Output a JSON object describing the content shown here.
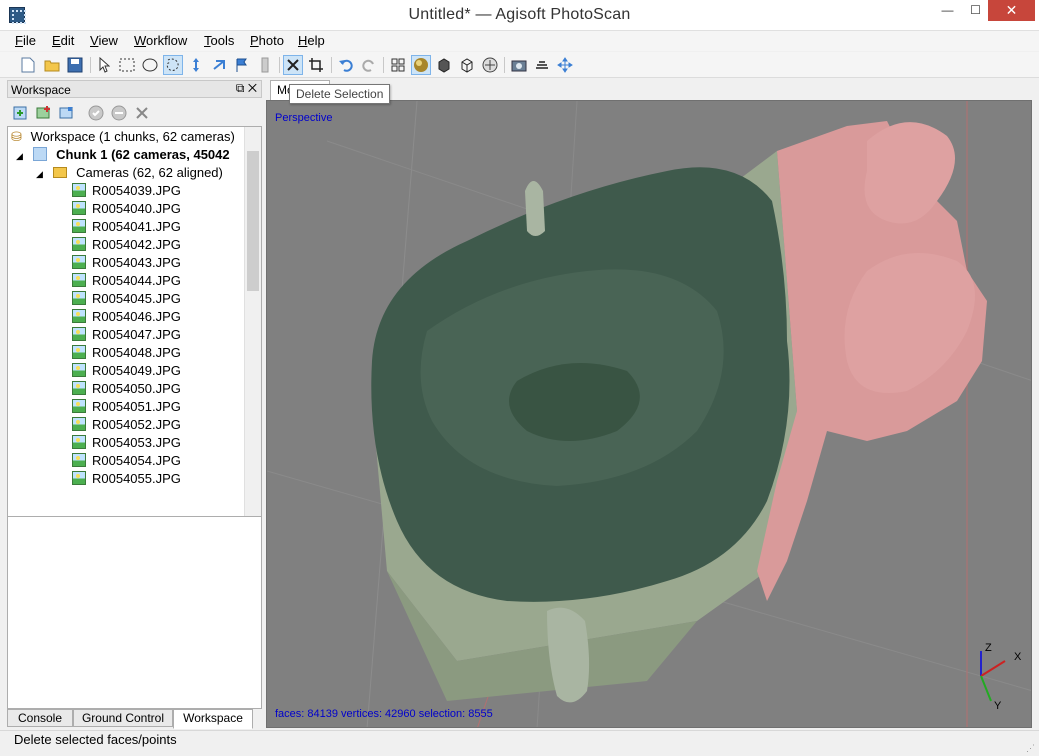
{
  "window": {
    "title": "Untitled* — Agisoft PhotoScan",
    "minimize_glyph": "—",
    "maximize_glyph": "☐",
    "close_glyph": "✕"
  },
  "menu": {
    "items": [
      {
        "label": "File",
        "accel": "F",
        "rest": "ile"
      },
      {
        "label": "Edit",
        "accel": "E",
        "rest": "dit"
      },
      {
        "label": "View",
        "accel": "V",
        "rest": "iew"
      },
      {
        "label": "Workflow",
        "accel": "W",
        "rest": "orkflow"
      },
      {
        "label": "Tools",
        "accel": "T",
        "rest": "ools"
      },
      {
        "label": "Photo",
        "accel": "P",
        "rest": "hoto"
      },
      {
        "label": "Help",
        "accel": "H",
        "rest": "elp"
      }
    ]
  },
  "toolbar": {
    "icons": [
      "new-file-icon",
      "open-folder-icon",
      "save-icon",
      "pointer-icon",
      "rectangle-selection-icon",
      "circle-selection-icon",
      "free-form-selection-icon",
      "move-region-icon",
      "rotate-region-icon",
      "resize-region-icon",
      "navigation-icon",
      "delete-selection-icon",
      "crop-selection-icon",
      "undo-icon",
      "redo-icon",
      "point-cloud-icon",
      "shaded-icon",
      "solid-icon",
      "wireframe-icon",
      "textured-icon",
      "show-cameras-icon",
      "show-ground-control-icon",
      "reset-view-icon"
    ],
    "tooltip": "Delete Selection"
  },
  "workspace": {
    "panel_title": "Workspace",
    "root_label": "Workspace (1 chunks, 62 cameras)",
    "chunk_label": "Chunk 1 (62 cameras, 45042",
    "cameras_label": "Cameras (62, 62 aligned)",
    "images": [
      "R0054039.JPG",
      "R0054040.JPG",
      "R0054041.JPG",
      "R0054042.JPG",
      "R0054043.JPG",
      "R0054044.JPG",
      "R0054045.JPG",
      "R0054046.JPG",
      "R0054047.JPG",
      "R0054048.JPG",
      "R0054049.JPG",
      "R0054050.JPG",
      "R0054051.JPG",
      "R0054052.JPG",
      "R0054053.JPG",
      "R0054054.JPG",
      "R0054055.JPG"
    ]
  },
  "bottom_tabs": [
    {
      "label": "Console",
      "active": false
    },
    {
      "label": "Ground Control",
      "active": false
    },
    {
      "label": "Workspace",
      "active": true
    }
  ],
  "viewport": {
    "tab_label": "Model",
    "projection": "Perspective",
    "stats": "faces: 84139 vertices: 42960 selection: 8555",
    "axes": {
      "x": "X",
      "y": "Y",
      "z": "Z"
    },
    "colors": {
      "background": "#808080",
      "rock": "#3f5a4c",
      "ground_plane": "#9aa88f",
      "selection": "#d99a9a",
      "label": "#0000cc"
    }
  },
  "status": {
    "text": "Delete selected faces/points"
  }
}
